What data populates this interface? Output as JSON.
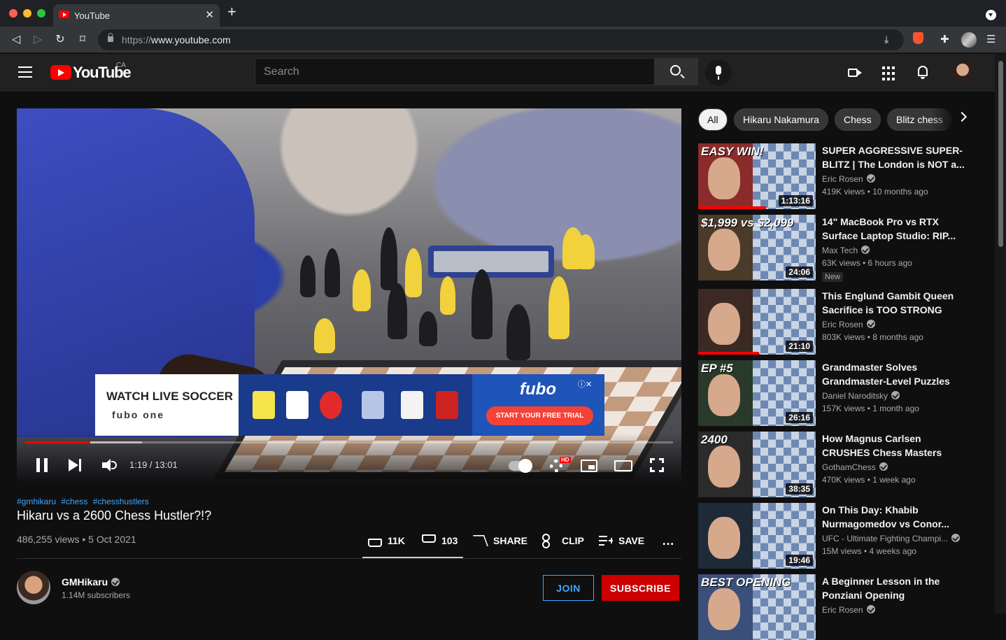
{
  "browser": {
    "tab_title": "YouTube",
    "tab_close": "✕",
    "new_tab": "+",
    "url_scheme": "https://",
    "url_host": "www.youtube.com"
  },
  "header": {
    "logo_text": "YouTube",
    "country": "CA",
    "search_placeholder": "Search"
  },
  "player": {
    "time": "1:19 / 13:01",
    "progress_fraction": 0.1,
    "hd_badge": "HD",
    "ad": {
      "headline": "WATCH LIVE SOCCER",
      "partners": "fubo  one",
      "brand": "fubo",
      "cta": "START YOUR FREE TRIAL",
      "close": "ⓘ✕"
    }
  },
  "video": {
    "tags": [
      "#gmhikaru",
      "#chess",
      "#chesshustlers"
    ],
    "title": "Hikaru vs a 2600 Chess Hustler?!?",
    "meta": "486,255 views • 5 Oct 2021",
    "likes": "11K",
    "dislikes": "103",
    "share_label": "SHARE",
    "clip_label": "CLIP",
    "save_label": "SAVE",
    "more_label": "…"
  },
  "channel": {
    "name": "GMHikaru",
    "subscribers": "1.14M subscribers",
    "join_label": "JOIN",
    "subscribe_label": "SUBSCRIBE"
  },
  "chips": [
    "All",
    "Hikaru Nakamura",
    "Chess",
    "Blitz chess"
  ],
  "recommendations": [
    {
      "title": "SUPER AGGRESSIVE SUPER-BLITZ | The London is NOT a...",
      "channel": "Eric Rosen",
      "meta": "419K views • 10 months ago",
      "duration": "1:13:16",
      "thumb_caption": "EASY WIN!",
      "badge": "",
      "watched": 0.58,
      "color": "#8b2b2b"
    },
    {
      "title": "14\" MacBook Pro vs RTX Surface Laptop Studio: RIP...",
      "channel": "Max Tech",
      "meta": "63K views • 6 hours ago",
      "duration": "24:06",
      "thumb_caption": "$1,999 vs $2,099",
      "badge": "New",
      "watched": 0,
      "color": "#4a3a2a"
    },
    {
      "title": "This Englund Gambit Queen Sacrifice is TOO STRONG",
      "channel": "Eric Rosen",
      "meta": "803K views • 8 months ago",
      "duration": "21:10",
      "thumb_caption": "",
      "badge": "",
      "watched": 0.52,
      "color": "#3b2a24"
    },
    {
      "title": "Grandmaster Solves Grandmaster-Level Puzzles",
      "channel": "Daniel Naroditsky",
      "meta": "157K views • 1 month ago",
      "duration": "26:16",
      "thumb_caption": "EP #5",
      "badge": "",
      "watched": 0,
      "color": "#2a3a2a"
    },
    {
      "title": "How Magnus Carlsen CRUSHES Chess Masters",
      "channel": "GothamChess",
      "meta": "470K views • 1 week ago",
      "duration": "38:35",
      "thumb_caption": "2400",
      "badge": "",
      "watched": 0,
      "color": "#2b2b2b"
    },
    {
      "title": "On This Day: Khabib Nurmagomedov vs Conor...",
      "channel": "UFC - Ultimate Fighting Champi...",
      "meta": "15M views • 4 weeks ago",
      "duration": "19:46",
      "thumb_caption": "",
      "badge": "",
      "watched": 0,
      "color": "#1e2a38"
    },
    {
      "title": "A Beginner Lesson in the Ponziani Opening",
      "channel": "Eric Rosen",
      "meta": "",
      "duration": "",
      "thumb_caption": "BEST OPENING",
      "badge": "",
      "watched": 0,
      "color": "#3a4f7a"
    }
  ]
}
